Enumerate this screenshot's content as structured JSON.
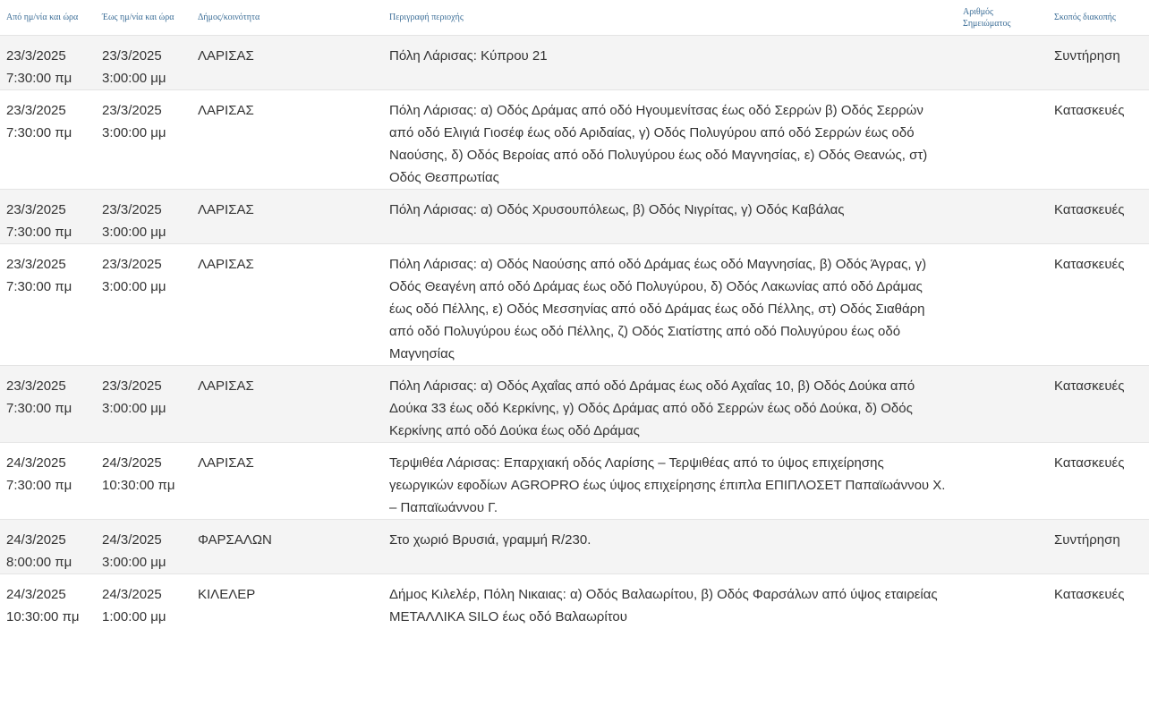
{
  "headers": {
    "from": "Από ημ/νία και ώρα",
    "to": "Έως ημ/νία και ώρα",
    "municipality": "Δήμος/κοινότητα",
    "area": "Περιγραφή περιοχής",
    "point_number": "Αριθμός Σημειώματος",
    "purpose": "Σκοπός διακοπής"
  },
  "rows": [
    {
      "from_date": "23/3/2025",
      "from_time": "7:30:00 πμ",
      "to_date": "23/3/2025",
      "to_time": "3:00:00 μμ",
      "municipality": "ΛΑΡΙΣΑΣ",
      "area": "Πόλη Λάρισας: Κύπρου 21",
      "point_number": "",
      "purpose": "Συντήρηση"
    },
    {
      "from_date": "23/3/2025",
      "from_time": "7:30:00 πμ",
      "to_date": "23/3/2025",
      "to_time": "3:00:00 μμ",
      "municipality": "ΛΑΡΙΣΑΣ",
      "area": "Πόλη Λάρισας: α) Οδός Δράμας από οδό Ηγουμενίτσας έως οδό Σερρών β) Οδός Σερρών από οδό Ελιγιά Γιοσέφ έως οδό Αριδαίας, γ) Οδός Πολυγύρου από οδό Σερρών έως οδό Ναούσης, δ) Οδός Βεροίας από οδό Πολυγύρου έως οδό Μαγνησίας, ε) Οδός Θεανώς, στ) Οδός Θεσπρωτίας",
      "point_number": "",
      "purpose": "Κατασκευές"
    },
    {
      "from_date": "23/3/2025",
      "from_time": "7:30:00 πμ",
      "to_date": "23/3/2025",
      "to_time": "3:00:00 μμ",
      "municipality": "ΛΑΡΙΣΑΣ",
      "area": "Πόλη Λάρισας: α) Οδός Χρυσουπόλεως, β) Οδός Νιγρίτας, γ) Οδός Καβάλας",
      "point_number": "",
      "purpose": "Κατασκευές"
    },
    {
      "from_date": "23/3/2025",
      "from_time": "7:30:00 πμ",
      "to_date": "23/3/2025",
      "to_time": "3:00:00 μμ",
      "municipality": "ΛΑΡΙΣΑΣ",
      "area": "Πόλη Λάρισας: α) Οδός Ναούσης από οδό Δράμας έως οδό Μαγνησίας, β) Οδός Άγρας, γ) Οδός Θεαγένη από οδό Δράμας έως οδό Πολυγύρου, δ) Οδός Λακωνίας από οδό Δράμας έως οδό Πέλλης, ε) Οδός Μεσσηνίας από οδό Δράμας έως οδό Πέλλης, στ) Οδός Σιαθάρη από οδό Πολυγύρου έως οδό Πέλλης, ζ) Οδός Σιατίστης από οδό Πολυγύρου έως οδό Μαγνησίας",
      "point_number": "",
      "purpose": "Κατασκευές"
    },
    {
      "from_date": "23/3/2025",
      "from_time": "7:30:00 πμ",
      "to_date": "23/3/2025",
      "to_time": "3:00:00 μμ",
      "municipality": "ΛΑΡΙΣΑΣ",
      "area": "Πόλη Λάρισας: α) Οδός Αχαΐας από οδό Δράμας έως οδό Αχαΐας 10, β) Οδός Δούκα από Δούκα 33 έως οδό Κερκίνης, γ) Οδός Δράμας από οδό Σερρών έως οδό Δούκα, δ) Οδός Κερκίνης από οδό Δούκα έως οδό Δράμας",
      "point_number": "",
      "purpose": "Κατασκευές"
    },
    {
      "from_date": "24/3/2025",
      "from_time": "7:30:00 πμ",
      "to_date": "24/3/2025",
      "to_time": "10:30:00 πμ",
      "municipality": "ΛΑΡΙΣΑΣ",
      "area": "Τερψιθέα Λάρισας: Επαρχιακή οδός Λαρίσης – Τερψιθέας από το ύψος επιχείρησης γεωργικών εφοδίων AGROPRO έως ύψος επιχείρησης έπιπλα ΕΠΙΠΛΟΣΕΤ Παπαϊωάννου Χ. – Παπαϊωάννου Γ.",
      "point_number": "",
      "purpose": "Κατασκευές"
    },
    {
      "from_date": "24/3/2025",
      "from_time": "8:00:00 πμ",
      "to_date": "24/3/2025",
      "to_time": "3:00:00 μμ",
      "municipality": "ΦΑΡΣΑΛΩΝ",
      "area": "Στο χωριό Βρυσιά, γραμμή R/230.",
      "point_number": "",
      "purpose": "Συντήρηση"
    },
    {
      "from_date": "24/3/2025",
      "from_time": "10:30:00 πμ",
      "to_date": "24/3/2025",
      "to_time": "1:00:00 μμ",
      "municipality": "ΚΙΛΕΛΕΡ",
      "area": "Δήμος Κιλελέρ, Πόλη Νικαιας: α) Οδός Βαλαωρίτου, β) Οδός Φαρσάλων από ύψος εταιρείας ΜΕΤΑΛΛΙΚΑ SILO έως οδό Βαλαωρίτου",
      "point_number": "",
      "purpose": "Κατασκευές"
    }
  ]
}
